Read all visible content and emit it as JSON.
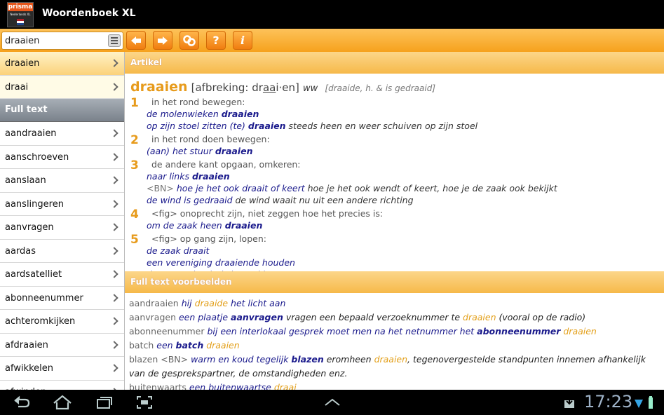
{
  "app": {
    "title": "Woordenboek XL",
    "logo_brand": "prisma",
    "logo_sub": "Nederlands XL"
  },
  "search": {
    "value": "draaien"
  },
  "toolbar": {
    "buttons": [
      "back-arrow-icon",
      "forward-arrow-icon",
      "link-icon",
      "help-icon",
      "info-icon"
    ],
    "help_label": "?",
    "info_label": "i"
  },
  "sidebar": {
    "top_items": [
      "draaien",
      "draai"
    ],
    "section_header": "Full text",
    "items": [
      "aandraaien",
      "aanschroeven",
      "aanslaan",
      "aanslingeren",
      "aanvragen",
      "aardas",
      "aardsatelliet",
      "abonneenummer",
      "achteromkijken",
      "afdraaien",
      "afwikkelen",
      "afwinden"
    ]
  },
  "article": {
    "header": "Artikel",
    "headword": "draaien",
    "hyphenation": "[afbreking: dr",
    "hyphenation_accent": "aa",
    "hyphenation_end": "i·en]",
    "pos": "ww",
    "forms": "[draaide, h. & is gedraaid]",
    "senses": [
      {
        "num": "1",
        "def": "in het rond bewegen:",
        "examples": [
          {
            "pre": "de molenwieken ",
            "bold": "draaien",
            "post": "",
            "expl": ""
          },
          {
            "pre": "op zijn stoel zitten (te) ",
            "bold": "draaien",
            "post": "",
            "expl": " steeds heen en weer schuiven op zijn stoel"
          }
        ]
      },
      {
        "num": "2",
        "def": "in het rond doen bewegen:",
        "examples": [
          {
            "pre": "(aan) het stuur ",
            "bold": "draaien",
            "post": "",
            "expl": ""
          }
        ]
      },
      {
        "num": "3",
        "def": "de andere kant opgaan, omkeren:",
        "examples": [
          {
            "pre": "naar links ",
            "bold": "draaien",
            "post": "",
            "expl": ""
          },
          {
            "tag": "<BN>",
            "pre": " hoe je het ook draait of keert",
            "bold": "",
            "post": "",
            "expl": " hoe je het ook wendt of keert, hoe je de zaak ook bekijkt"
          },
          {
            "pre": "de wind is gedraaid",
            "bold": "",
            "post": "",
            "expl": " de wind waait nu uit een andere richting"
          }
        ]
      },
      {
        "num": "4",
        "def": "<fig> onoprecht zijn, niet zeggen hoe het precies is:",
        "examples": [
          {
            "pre": "om de zaak heen ",
            "bold": "draaien",
            "post": "",
            "expl": ""
          }
        ]
      },
      {
        "num": "5",
        "def": "<fig> op gang zijn, lopen:",
        "examples": [
          {
            "pre": "de zaak draait",
            "bold": "",
            "post": "",
            "expl": ""
          },
          {
            "pre": "een vereniging draaiende houden",
            "bold": "",
            "post": "",
            "expl": ""
          },
          {
            "pre": "de motor draait, is in werking",
            "bold": "",
            "post": "",
            "expl": ""
          }
        ]
      }
    ]
  },
  "fulltext": {
    "header": "Full text voorbeelden",
    "rows": [
      {
        "kw": "aandraaien",
        "parts": [
          [
            "b",
            " hij "
          ],
          [
            "o",
            "draaide"
          ],
          [
            "b",
            " het licht aan"
          ]
        ]
      },
      {
        "kw": "aanvragen",
        "parts": [
          [
            "b",
            " een plaatje "
          ],
          [
            "bb",
            "aanvragen"
          ],
          [
            "p",
            " vragen een bepaald verzoeknummer te "
          ],
          [
            "o",
            "draaien"
          ],
          [
            "p",
            " (vooral op de radio)"
          ]
        ]
      },
      {
        "kw": "abonneenummer",
        "parts": [
          [
            "b",
            " bij een interlokaal gesprek moet men na het netnummer het "
          ],
          [
            "bb",
            "abonneenummer"
          ],
          [
            "o",
            " draaien"
          ]
        ]
      },
      {
        "kw": "batch",
        "parts": [
          [
            "b",
            " een "
          ],
          [
            "bb",
            "batch"
          ],
          [
            "o",
            " draaien"
          ]
        ]
      },
      {
        "kw": "blazen",
        "parts": [
          [
            "g",
            " <BN>"
          ],
          [
            "b",
            " warm en koud tegelijk "
          ],
          [
            "bb",
            "blazen"
          ],
          [
            "p",
            " eromheen "
          ],
          [
            "o",
            "draaien"
          ],
          [
            "p",
            ", tegenovergestelde standpunten innemen afhankelijk van de gesprekspartner, de omstandigheden enz."
          ]
        ]
      },
      {
        "kw": "buitenwaarts",
        "parts": [
          [
            "b",
            " een buitenwaartse "
          ],
          [
            "o",
            "draai"
          ]
        ]
      }
    ]
  },
  "statusbar": {
    "time": "17:23"
  }
}
